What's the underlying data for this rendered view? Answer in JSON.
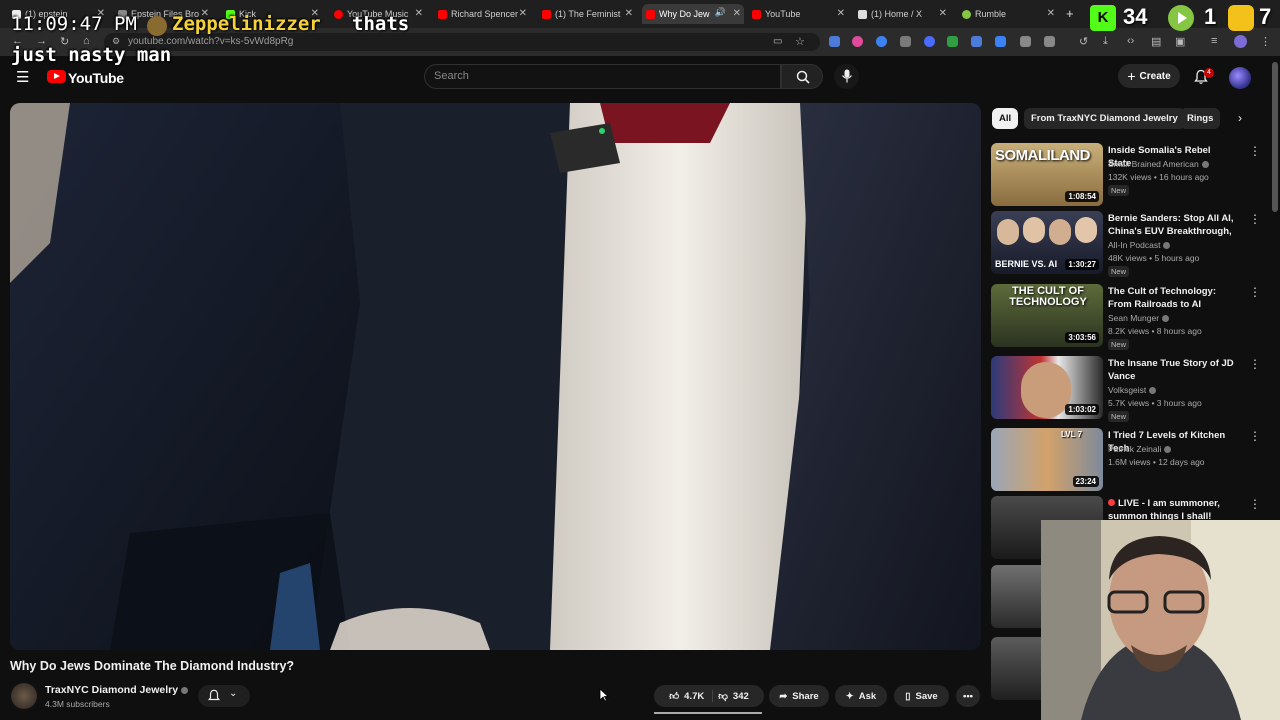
{
  "browser": {
    "tabs": [
      {
        "label": "(1) epstein",
        "color": "#ffffff"
      },
      {
        "label": "Epstein Files Bro",
        "color": "#ffffff"
      },
      {
        "label": "Kick",
        "color": "#53fc18"
      },
      {
        "label": "YouTube Music",
        "color": "#ff0000"
      },
      {
        "label": "Richard Spencer",
        "color": "#ff0000"
      },
      {
        "label": "(1) The Feminist",
        "color": "#ff0000"
      },
      {
        "label": "Why Do Jew",
        "color": "#ff0000"
      },
      {
        "label": "YouTube",
        "color": "#ff0000"
      },
      {
        "label": "(1) Home / X",
        "color": "#ffffff"
      },
      {
        "label": "Rumble",
        "color": "#85c742"
      }
    ],
    "url": "youtube.com/watch?v=ks-5vWd8pRg"
  },
  "overlay": {
    "time": "11:09:47 PM",
    "chat_user": "Zeppelinizzer",
    "chat_text_1": "thats",
    "chat_text_2": "just nasty man",
    "counter_1": "34",
    "counter_2": "1",
    "counter_3": "7"
  },
  "header": {
    "logo": "YouTube",
    "search_placeholder": "Search",
    "create_label": "Create",
    "notification_count": "4"
  },
  "video": {
    "title": "Why Do Jews Dominate The Diamond Industry?",
    "channel": "TraxNYC Diamond Jewelry",
    "subscribers": "4.3M subscribers",
    "likes": "4.7K",
    "dislikes": "342",
    "share_label": "Share",
    "ask_label": "Ask",
    "save_label": "Save"
  },
  "sidebar": {
    "chips": [
      "All",
      "From TraxNYC Diamond Jewelry",
      "Rings"
    ],
    "recommendations": [
      {
        "title": "Inside Somalia's Rebel State",
        "channel": "Small Brained American",
        "meta": "132K views • 16 hours ago",
        "badge": "New",
        "duration": "1:08:54",
        "thumb_text": "SOMALILAND"
      },
      {
        "title": "Bernie Sanders: Stop All AI, China's EUV Breakthrough, ...",
        "channel": "All-In Podcast",
        "meta": "48K views • 5 hours ago",
        "badge": "New",
        "duration": "1:30:27",
        "thumb_text": "BERNIE VS. AI"
      },
      {
        "title": "The Cult of Technology: From Railroads to AI",
        "channel": "Sean Munger",
        "meta": "8.2K views • 8 hours ago",
        "badge": "New",
        "duration": "3:03:56",
        "thumb_text": "THE CULT OF TECHNOLOGY"
      },
      {
        "title": "The Insane True Story of JD Vance",
        "channel": "Volksgeist",
        "meta": "5.7K views • 3 hours ago",
        "badge": "New",
        "duration": "1:03:02",
        "thumb_text": ""
      },
      {
        "title": "I Tried 7 Levels of Kitchen Tech",
        "channel": "Patrick Zeinali",
        "meta": "1.6M views • 12 days ago",
        "badge": "",
        "duration": "23:24",
        "thumb_text": "LVL 7"
      },
      {
        "title": "LIVE - I am summoner, summon things I shall!",
        "channel": "",
        "meta": "",
        "badge": "",
        "duration": "",
        "thumb_text": ""
      }
    ]
  }
}
